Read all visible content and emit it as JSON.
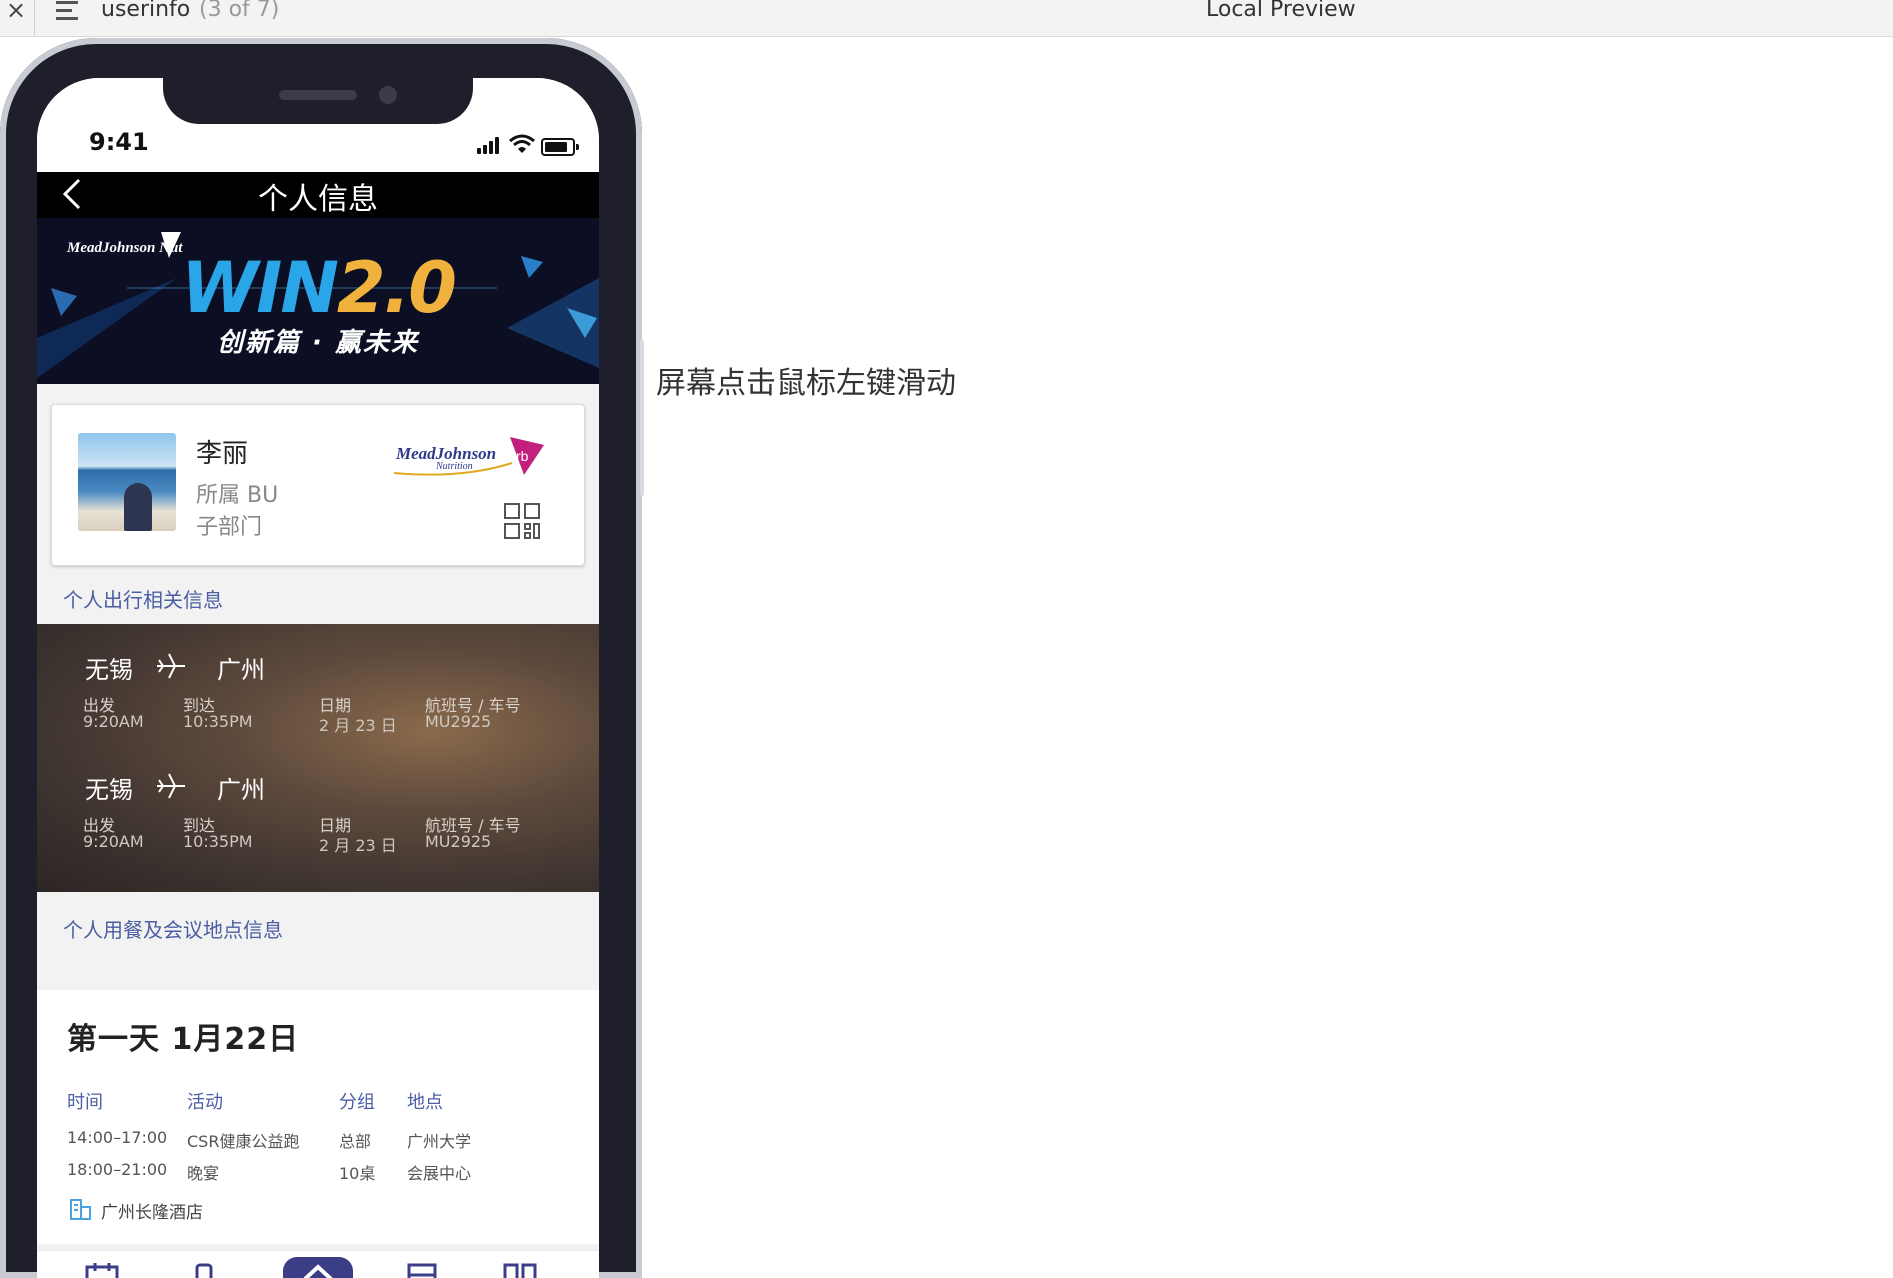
{
  "window": {
    "close_glyph": "×",
    "title": "userinfo",
    "count": "(3 of 7)",
    "preview_label": "Local Preview"
  },
  "status": {
    "time": "9:41"
  },
  "nav": {
    "title": "个人信息"
  },
  "banner": {
    "brand": "MeadJohnson Nutrition",
    "headline_a": "WIN",
    "headline_b": "2.0",
    "slogan": "创新篇 · 赢未来"
  },
  "profile": {
    "name": "李丽",
    "bu": "所属 BU",
    "dept": "子部门",
    "logo_text": "MeadJohnson",
    "logo_sub": "Nutrition",
    "logo_mark": "rb"
  },
  "sections": {
    "travel_title": "个人出行相关信息",
    "meeting_title": "个人用餐及会议地点信息"
  },
  "travel": [
    {
      "from": "无锡",
      "to": "广州",
      "labels": [
        "出发",
        "到达",
        "日期",
        "航班号 / 车号"
      ],
      "values": [
        "9:20AM",
        "10:35PM",
        "2 月 23 日",
        "MU2925"
      ]
    },
    {
      "from": "无锡",
      "to": "广州",
      "labels": [
        "出发",
        "到达",
        "日期",
        "航班号 / 车号"
      ],
      "values": [
        "9:20AM",
        "10:35PM",
        "2 月 23 日",
        "MU2925"
      ]
    }
  ],
  "meeting": {
    "day": "第一天  1月22日",
    "headers": [
      "时间",
      "活动",
      "分组",
      "地点"
    ],
    "rows": [
      [
        "14:00–17:00",
        "CSR健康公益跑",
        "总部",
        "广州大学"
      ],
      [
        "18:00–21:00",
        "晚宴",
        "10桌",
        "会展中心"
      ]
    ],
    "hotel": "广州长隆酒店"
  },
  "hint": "屏幕点击鼠标左键滑动",
  "colors": {
    "accent": "#4b5ea3",
    "tab_active": "#3b3d86",
    "nav_bg": "#000000"
  }
}
